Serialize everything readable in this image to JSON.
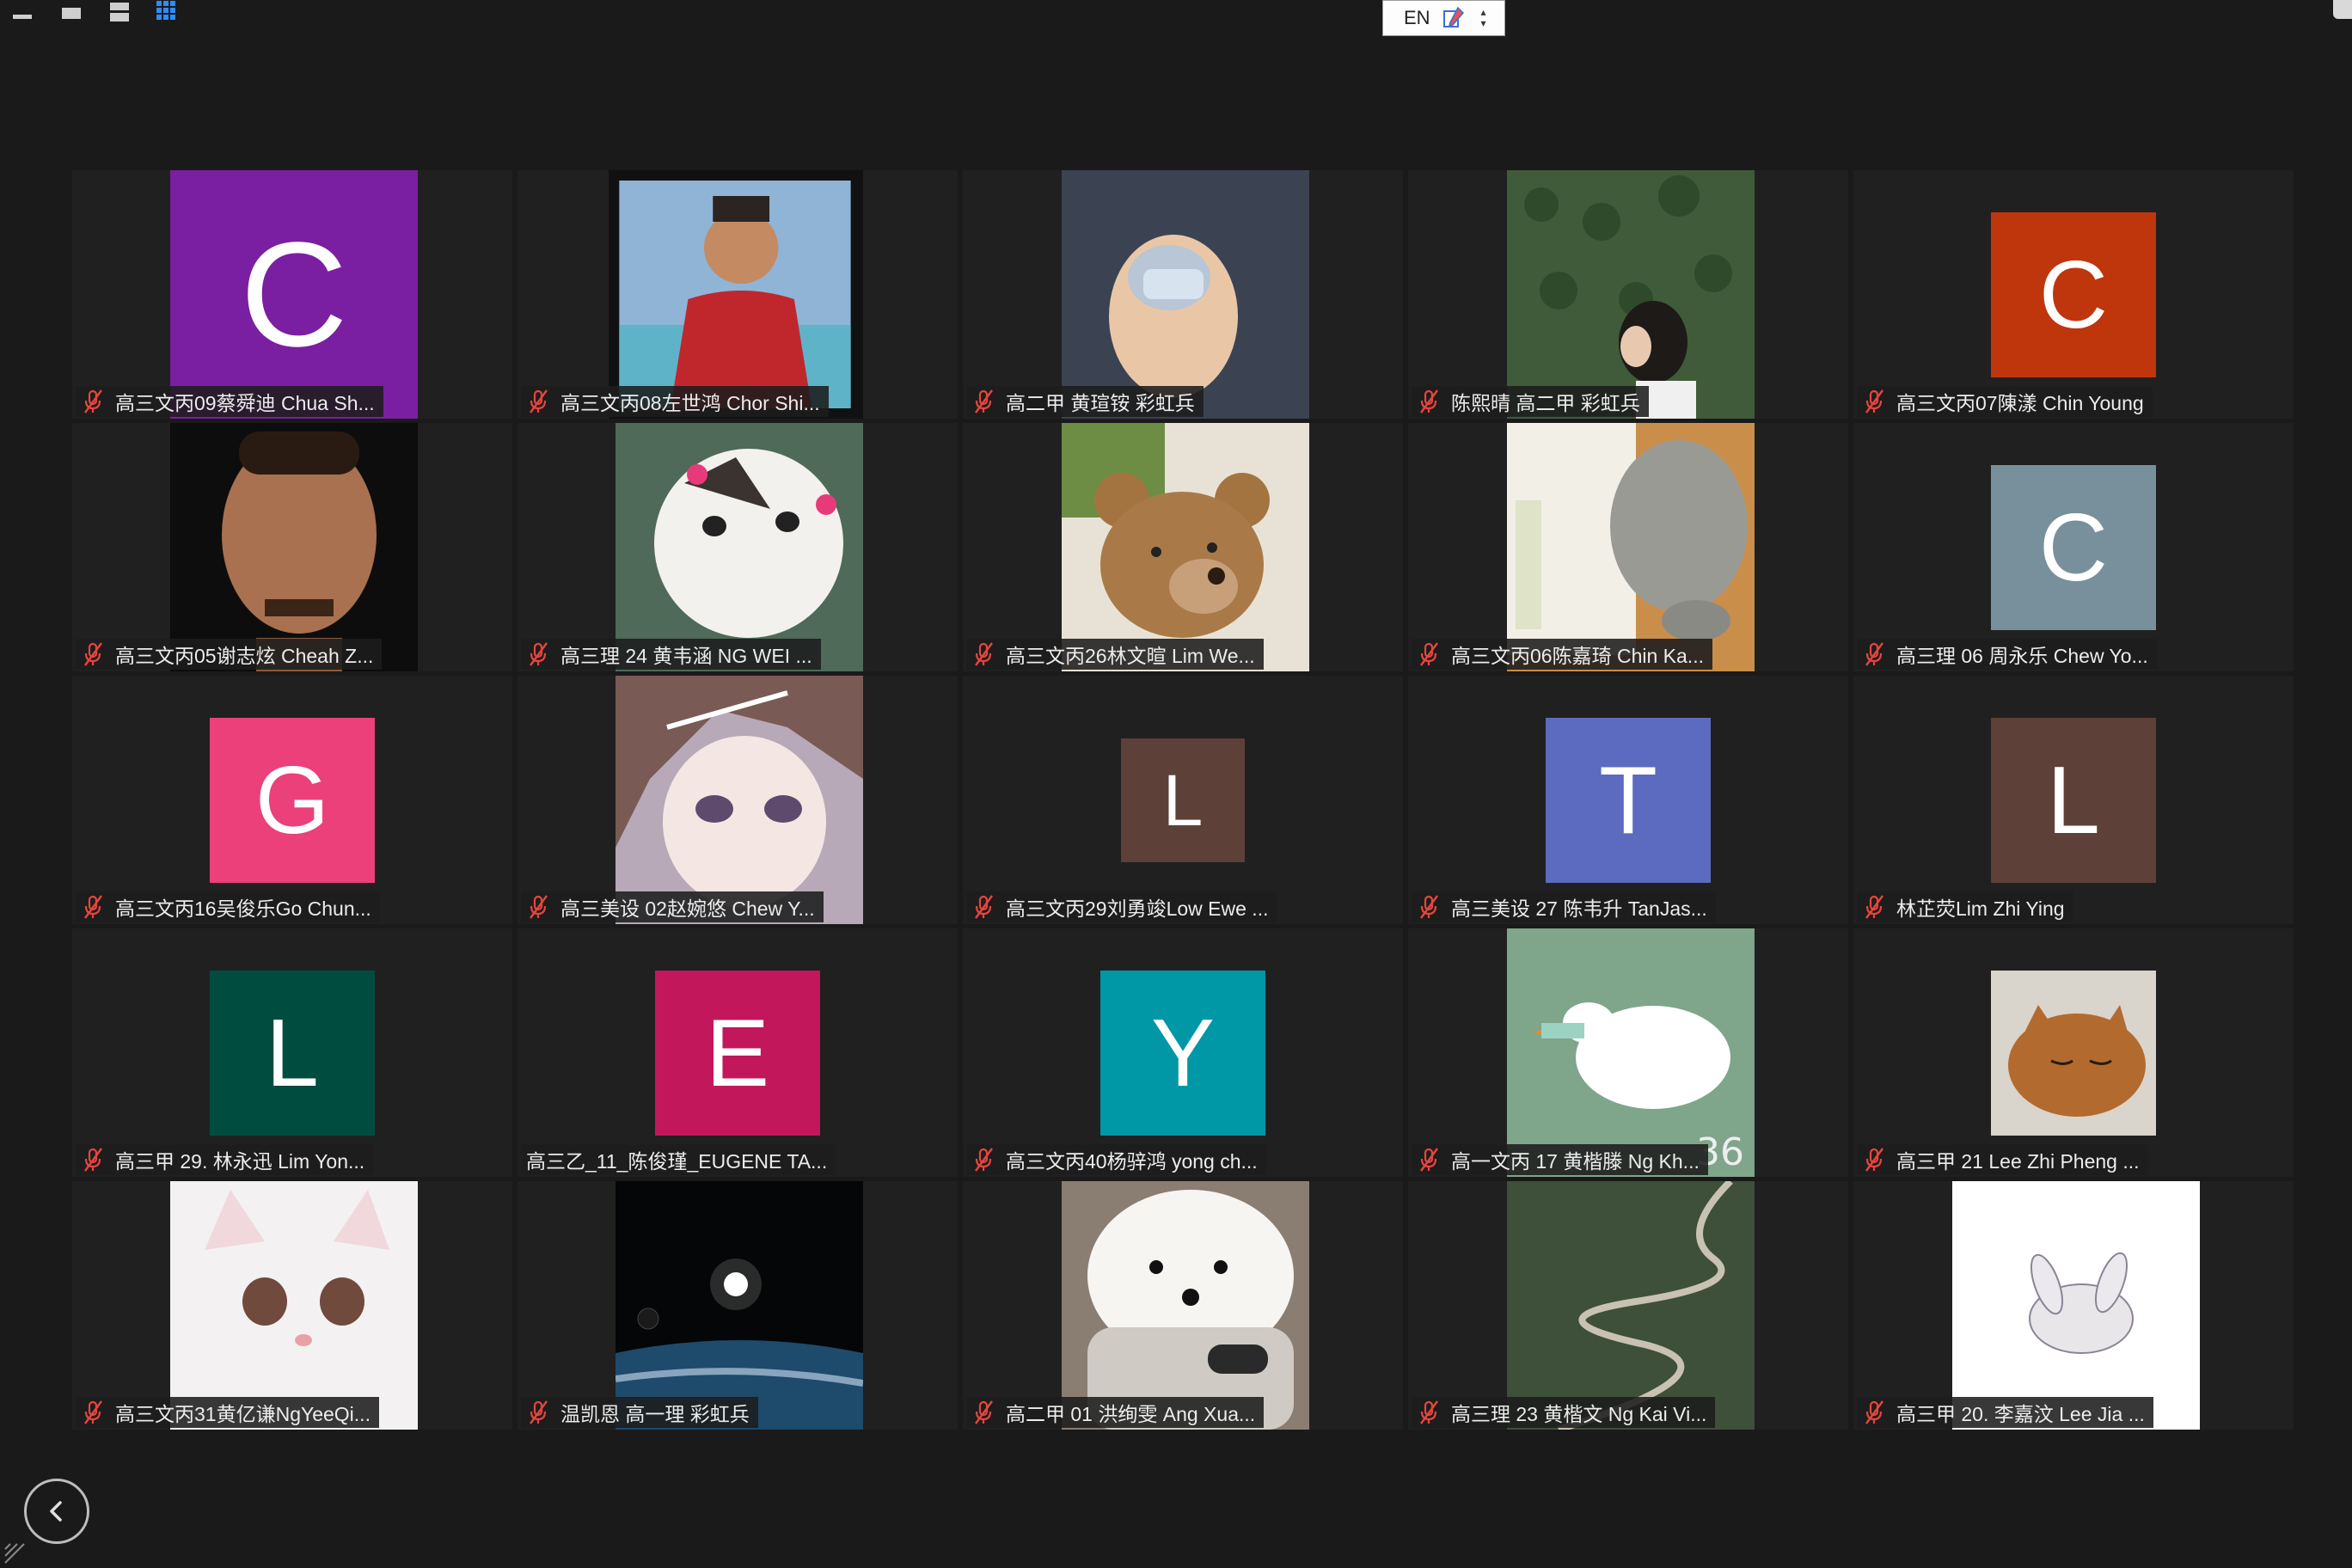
{
  "toolbar": {
    "buttons": [
      {
        "name": "minimize-view-button",
        "icon": "minimize-icon"
      },
      {
        "name": "speaker-view-button",
        "icon": "single-window-icon"
      },
      {
        "name": "strip-view-button",
        "icon": "strip-view-icon"
      },
      {
        "name": "gallery-view-button",
        "icon": "grid-icon",
        "active": true
      }
    ]
  },
  "language_bar": {
    "code": "EN",
    "icon": "input-method-icon"
  },
  "colors": {
    "background": "#1a1a1a",
    "tile": "#202020",
    "accent": "#2d8cff",
    "muted_mic": "#e8453c"
  },
  "participants": [
    {
      "name": "高三文丙09蔡舜迪 Chua Sh...",
      "muted": true,
      "avatar": {
        "type": "initial",
        "letter": "C",
        "color": "#7b1fa2"
      }
    },
    {
      "name": "高三文丙08左世鸿 Chor Shi...",
      "muted": true,
      "avatar": {
        "type": "photo",
        "subject": "young man in red tank top by pool"
      }
    },
    {
      "name": "高二甲 黄瑄铵  彩虹兵",
      "muted": true,
      "avatar": {
        "type": "photo",
        "subject": "kitten with surgical mask"
      }
    },
    {
      "name": "陈熙晴 高二甲 彩虹兵",
      "muted": true,
      "avatar": {
        "type": "photo",
        "subject": "girl in front of plant wall"
      }
    },
    {
      "name": "高三文丙07陳漾 Chin Young",
      "muted": true,
      "avatar": {
        "type": "initial",
        "letter": "C",
        "color": "#bf360c"
      }
    },
    {
      "name": "高三文丙05谢志炫 Cheah Z...",
      "muted": true,
      "avatar": {
        "type": "photo",
        "subject": "man portrait"
      }
    },
    {
      "name": "高三理 24 黄韦涵 NG WEI ...",
      "muted": true,
      "avatar": {
        "type": "photo",
        "subject": "calico cat with pink bows"
      }
    },
    {
      "name": "高三文丙26林文暄 Lim We...",
      "muted": true,
      "avatar": {
        "type": "photo",
        "subject": "teddy bear"
      }
    },
    {
      "name": "高三文丙06陈嘉琦 Chin Ka...",
      "muted": true,
      "avatar": {
        "type": "photo",
        "subject": "cat sleeping on book"
      }
    },
    {
      "name": "高三理 06 周永乐 Chew Yo...",
      "muted": true,
      "avatar": {
        "type": "initial",
        "letter": "C",
        "color": "#78909c"
      }
    },
    {
      "name": "高三文丙16吴俊乐Go Chun...",
      "muted": true,
      "avatar": {
        "type": "initial",
        "letter": "G",
        "color": "#ec407a"
      }
    },
    {
      "name": "高三美设 02赵婉悠 Chew Y...",
      "muted": true,
      "avatar": {
        "type": "photo",
        "subject": "anime girl"
      }
    },
    {
      "name": "高三文丙29刘勇竣Low Ewe ...",
      "muted": true,
      "avatar": {
        "type": "initial",
        "letter": "L",
        "color": "#5d4037"
      }
    },
    {
      "name": "高三美设 27 陈韦升 TanJas...",
      "muted": true,
      "avatar": {
        "type": "initial",
        "letter": "T",
        "color": "#5c6bc0"
      }
    },
    {
      "name": "林芷荧Lim Zhi Ying",
      "muted": true,
      "avatar": {
        "type": "initial",
        "letter": "L",
        "color": "#5d4037"
      }
    },
    {
      "name": "高三甲 29. 林永迅 Lim Yon...",
      "muted": true,
      "avatar": {
        "type": "initial",
        "letter": "L",
        "color": "#004d40"
      }
    },
    {
      "name": "高三乙_11_陈俊瑾_EUGENE TA...",
      "muted": false,
      "avatar": {
        "type": "initial",
        "letter": "E",
        "color": "#c2185b"
      }
    },
    {
      "name": "高三文丙40杨骍鸿 yong ch...",
      "muted": true,
      "avatar": {
        "type": "initial",
        "letter": "Y",
        "color": "#0097a7"
      }
    },
    {
      "name": "高一文丙 17 黄楷滕 Ng Kh...",
      "muted": true,
      "avatar": {
        "type": "photo",
        "subject": "goose cartoon",
        "overlay_text": "36"
      }
    },
    {
      "name": "高三甲 21 Lee Zhi Pheng ...",
      "muted": true,
      "avatar": {
        "type": "photo",
        "subject": "sleeping orange cat"
      }
    },
    {
      "name": "高三文丙31黄亿谦NgYeeQi...",
      "muted": true,
      "avatar": {
        "type": "photo",
        "subject": "white fluffy kitten"
      }
    },
    {
      "name": "温凯恩 高一理 彩虹兵",
      "muted": true,
      "avatar": {
        "type": "photo",
        "subject": "planet and moon over earth"
      }
    },
    {
      "name": "高二甲 01 洪绚雯 Ang Xua...",
      "muted": true,
      "avatar": {
        "type": "photo",
        "subject": "white puppy with phone"
      }
    },
    {
      "name": "高三理 23 黄楷文 Ng Kai Vi...",
      "muted": true,
      "avatar": {
        "type": "photo",
        "subject": "winding mountain road"
      }
    },
    {
      "name": "高三甲 20. 李嘉汶 Lee Jia ...",
      "muted": true,
      "avatar": {
        "type": "photo",
        "subject": "sketch of rabbit"
      }
    }
  ],
  "back_button": {
    "icon": "chevron-left-icon"
  }
}
